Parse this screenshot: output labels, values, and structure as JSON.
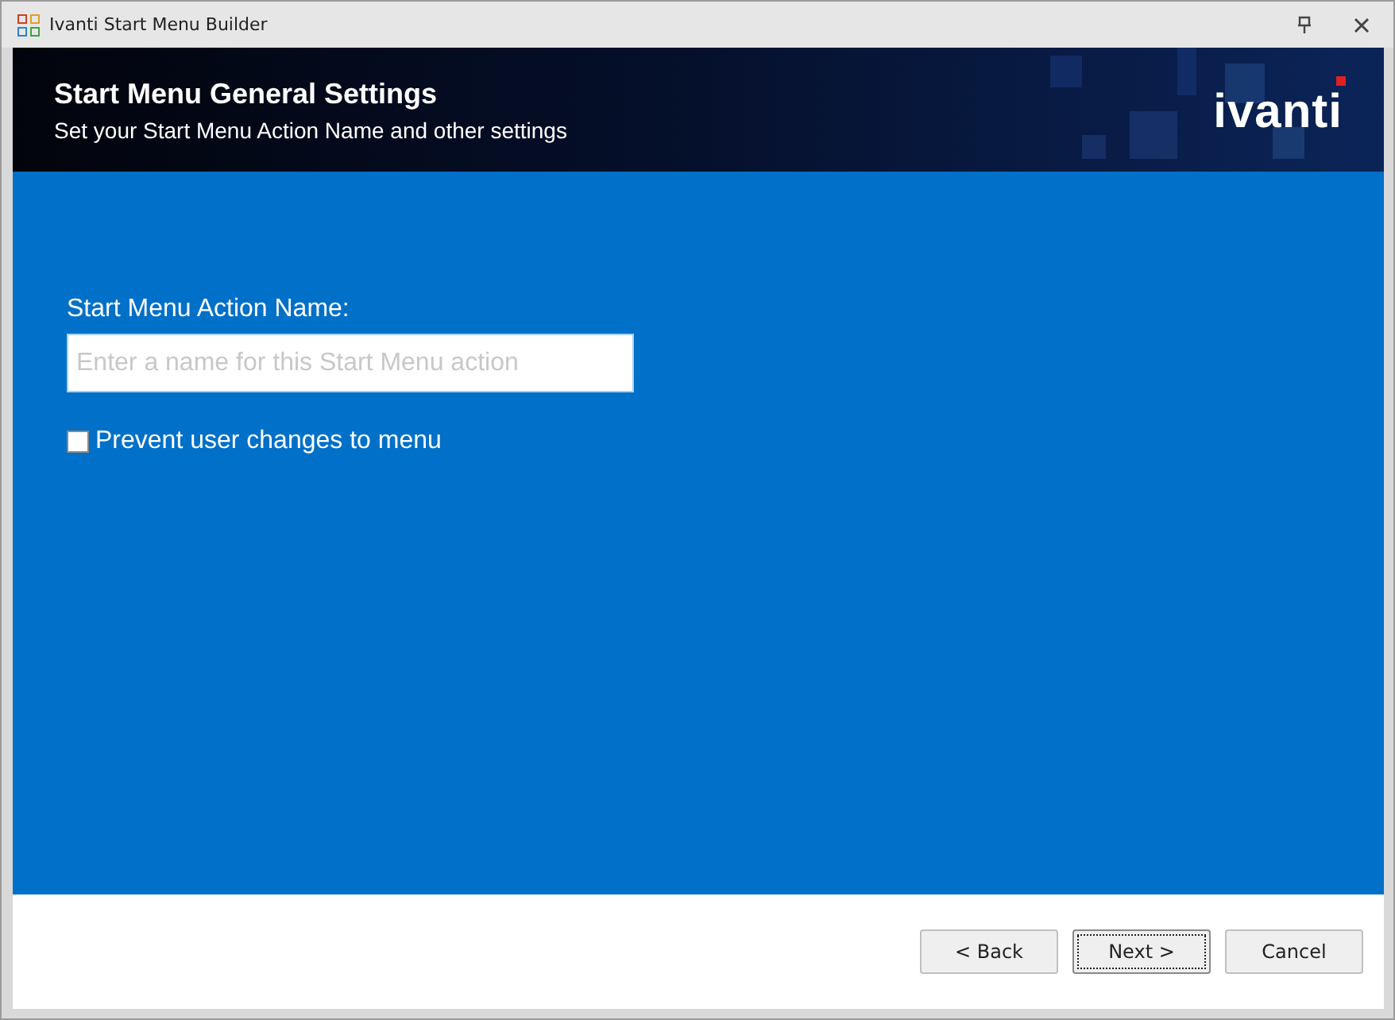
{
  "window": {
    "title": "Ivanti Start Menu Builder"
  },
  "header": {
    "title": "Start Menu General Settings",
    "subtitle": "Set your Start Menu Action Name and other settings",
    "logo": "ivanti"
  },
  "form": {
    "name_label": "Start Menu Action Name:",
    "name_field": {
      "placeholder": "Enter a name for this Start Menu action"
    },
    "prevent_changes": {
      "label": "Prevent user changes to menu",
      "checked": false
    }
  },
  "buttons": [
    {
      "label": "< Back",
      "focused": false
    },
    {
      "label": "Next >",
      "focused": true
    },
    {
      "label": "Cancel",
      "focused": false
    }
  ]
}
